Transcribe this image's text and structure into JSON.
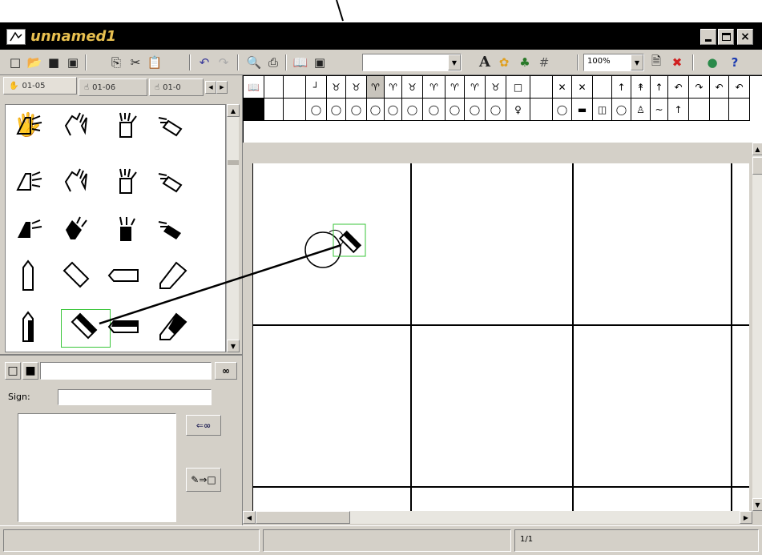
{
  "window": {
    "title": "unnamed1"
  },
  "toolbar": {
    "font_combo_value": "",
    "zoom_value": "100%",
    "text_tool": "A"
  },
  "tabs": [
    "01-05",
    "01-06",
    "01-0"
  ],
  "palette_row1": [
    "",
    "",
    "┘",
    "♉",
    "♉",
    "♈",
    "♈",
    "♉",
    "♈",
    "♈",
    "♈",
    "♉",
    "□",
    "",
    "✕",
    "✕",
    "",
    "↑",
    "↟",
    "↑",
    "↶",
    "↷",
    "↶",
    "↶"
  ],
  "palette_row2": [
    "",
    "",
    "◯",
    "◯",
    "◯",
    "◯",
    "◯",
    "◯",
    "◯",
    "◯",
    "◯",
    "◯",
    "♀",
    "",
    "◯",
    "▬",
    "◫",
    "◯",
    "♙",
    "~",
    "↑",
    "",
    "",
    ""
  ],
  "search": {
    "value": ""
  },
  "sign": {
    "label": "Sign:",
    "value": ""
  },
  "status": {
    "page": "1/1"
  }
}
